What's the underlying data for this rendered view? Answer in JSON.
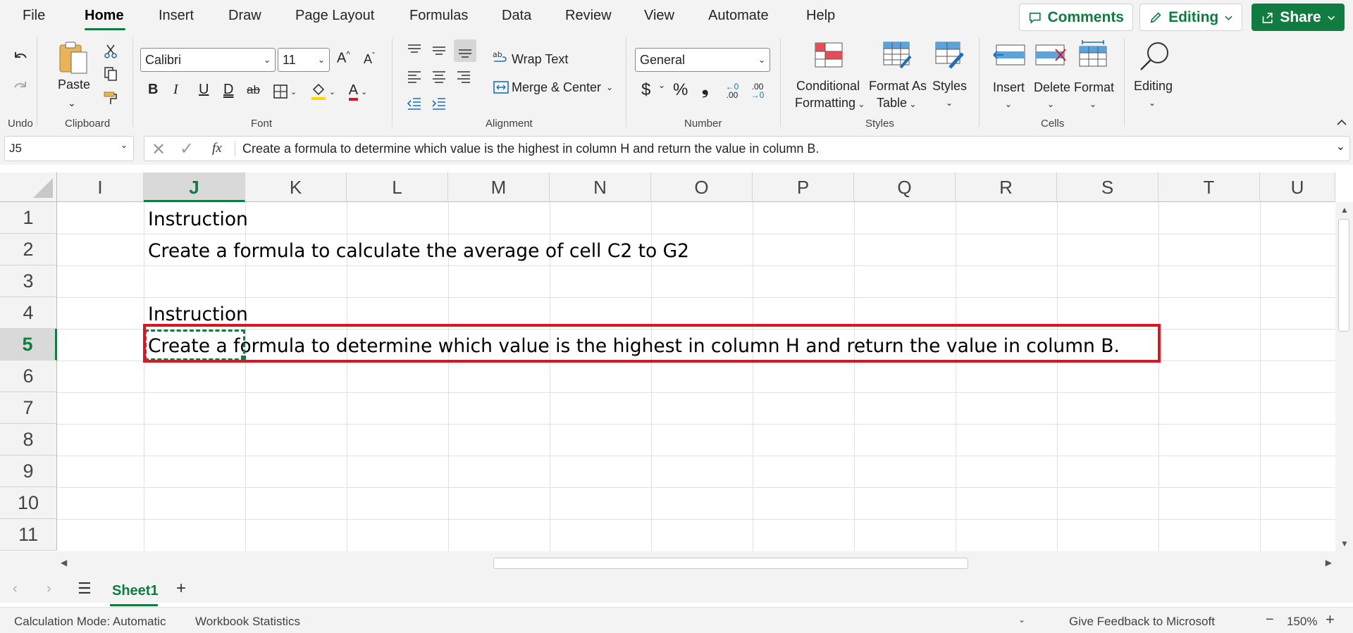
{
  "menu": {
    "items": [
      "File",
      "Home",
      "Insert",
      "Draw",
      "Page Layout",
      "Formulas",
      "Data",
      "Review",
      "View",
      "Automate",
      "Help"
    ],
    "active": "Home",
    "comments": "Comments",
    "editing": "Editing",
    "share": "Share"
  },
  "ribbon": {
    "undo_group": "Undo",
    "clipboard": {
      "paste": "Paste",
      "group": "Clipboard"
    },
    "font": {
      "name": "Calibri",
      "size": "11",
      "group": "Font",
      "grow": "A",
      "shrink": "A",
      "bold": "B",
      "italic": "I",
      "underline": "U",
      "double_underline": "D",
      "strike": "ab",
      "font_color": "A"
    },
    "alignment": {
      "wrap_text": "Wrap Text",
      "merge_center": "Merge & Center",
      "group": "Alignment"
    },
    "number": {
      "format": "General",
      "currency": "$",
      "percent": "%",
      "comma": "❟",
      "inc_decimal": ".00",
      "dec_decimal": ".00",
      "group": "Number"
    },
    "styles": {
      "conditional": "Conditional",
      "formatting": "Formatting",
      "format_as": "Format As",
      "table": "Table",
      "styles": "Styles",
      "group": "Styles"
    },
    "cells": {
      "insert": "Insert",
      "delete": "Delete",
      "format": "Format",
      "group": "Cells"
    },
    "editing": {
      "label": "Editing"
    }
  },
  "formula_bar": {
    "name_box": "J5",
    "fx": "fx",
    "value": "Create a formula to determine which value is the highest in column H and return the value in column B."
  },
  "grid": {
    "columns": [
      "I",
      "J",
      "K",
      "L",
      "M",
      "N",
      "O",
      "P",
      "Q",
      "R",
      "S",
      "T",
      "U"
    ],
    "selected_column": "J",
    "rows": [
      "1",
      "2",
      "3",
      "4",
      "5",
      "6",
      "7",
      "8",
      "9",
      "10",
      "11"
    ],
    "selected_row": "5",
    "cells": {
      "J1": "Instruction",
      "J2": "Create a formula to calculate the average of cell C2 to G2",
      "J4": "Instruction",
      "J5": "Create a formula to determine which value is the highest in column H and return the value in column B."
    },
    "highlight_color": "#e0141e",
    "accent_color": "#107c41"
  },
  "sheets": {
    "tabs": [
      "Sheet1"
    ],
    "active": "Sheet1"
  },
  "status": {
    "calc_mode": "Calculation Mode: Automatic",
    "workbook_stats": "Workbook Statistics",
    "feedback": "Give Feedback to Microsoft",
    "zoom": "150%"
  }
}
